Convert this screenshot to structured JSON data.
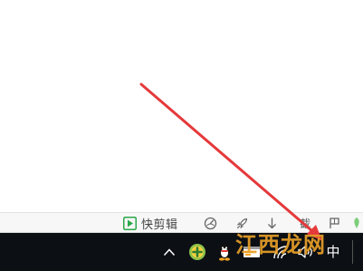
{
  "toolbar": {
    "quick_edit_label": "快剪辑",
    "partial_label": "截"
  },
  "taskbar": {
    "ime_label": "中",
    "tray_icons": [
      "chevron-up-icon",
      "green-plus-icon",
      "qq-penguin-icon",
      "app-window-icon",
      "network-icon",
      "volume-icon"
    ]
  },
  "watermark": {
    "text": "江西龙网"
  },
  "colors": {
    "arrow": "#e5393b",
    "taskbar": "#0c0f14",
    "toolbar": "#f7f7f7",
    "quick_edit_green": "#2ba84a",
    "watermark": "#e8a028"
  }
}
